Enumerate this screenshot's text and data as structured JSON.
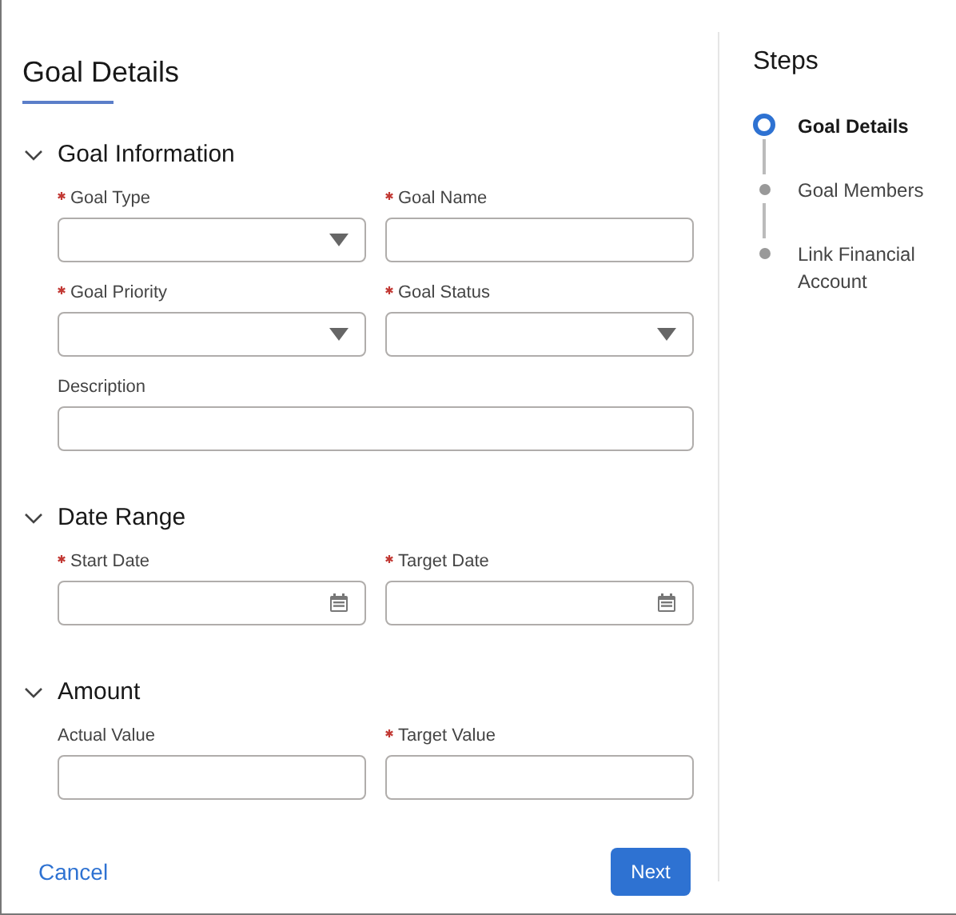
{
  "form": {
    "title": "Goal Details",
    "sections": [
      {
        "title": "Goal Information",
        "expanded": true,
        "fields": [
          {
            "label": "Goal Type",
            "required": true,
            "kind": "select"
          },
          {
            "label": "Goal Name",
            "required": true,
            "kind": "text"
          },
          {
            "label": "Goal Priority",
            "required": true,
            "kind": "select"
          },
          {
            "label": "Goal Status",
            "required": true,
            "kind": "select"
          },
          {
            "label": "Description",
            "required": false,
            "kind": "wide"
          }
        ]
      },
      {
        "title": "Date Range",
        "expanded": true,
        "fields": [
          {
            "label": "Start Date",
            "required": true,
            "kind": "date"
          },
          {
            "label": "Target Date",
            "required": true,
            "kind": "date"
          }
        ]
      },
      {
        "title": "Amount",
        "expanded": true,
        "fields": [
          {
            "label": "Actual Value",
            "required": false,
            "kind": "text"
          },
          {
            "label": "Target Value",
            "required": true,
            "kind": "text"
          }
        ]
      }
    ],
    "buttons": {
      "cancel": "Cancel",
      "next": "Next"
    }
  },
  "steps": {
    "title": "Steps",
    "items": [
      {
        "label": "Goal Details",
        "selected": true
      },
      {
        "label": "Goal Members",
        "selected": false
      },
      {
        "label": "Link Financial Account",
        "selected": false
      }
    ]
  }
}
